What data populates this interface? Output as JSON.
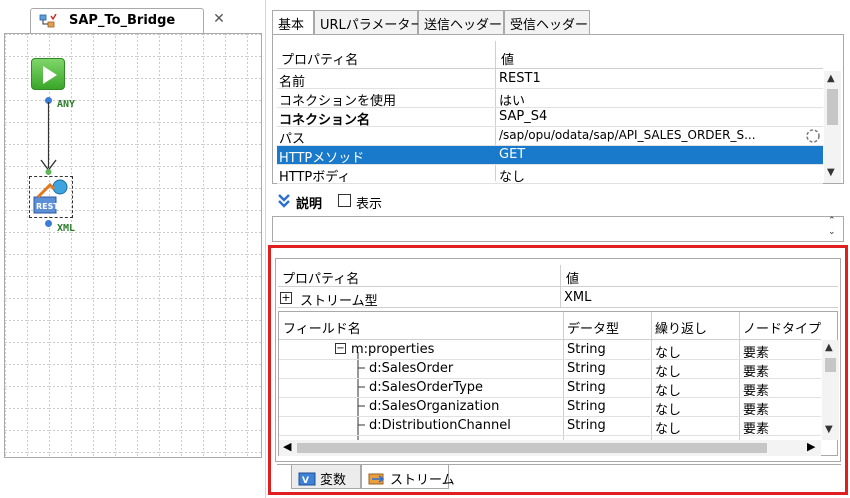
{
  "flow_tab": {
    "title": "SAP_To_Bridge",
    "close_glyph": "✕"
  },
  "flow": {
    "start_port_label": "ANY",
    "rest_port_label": "XML"
  },
  "property_tabs": [
    "基本",
    "URLパラメーター",
    "送信ヘッダー",
    "受信ヘッダー"
  ],
  "properties": {
    "header": {
      "name": "プロパティ名",
      "value": "値"
    },
    "rows": [
      {
        "key": "名前",
        "value": "REST1"
      },
      {
        "key": "コネクションを使用",
        "value": "はい"
      },
      {
        "key": "コネクション名",
        "value": "SAP_S4"
      },
      {
        "key": "パス",
        "value": "/sap/opu/odata/sap/API_SALES_ORDER_S..."
      },
      {
        "key": "HTTPメソッド",
        "value": "GET"
      },
      {
        "key": "HTTPボディ",
        "value": "なし"
      }
    ],
    "selected_row": 4
  },
  "description": {
    "label": "説明",
    "checkbox_label": "表示"
  },
  "stream": {
    "header": {
      "name": "プロパティ名",
      "value": "値"
    },
    "type_row": {
      "key": "ストリーム型",
      "value": "XML",
      "expander": "⊞"
    },
    "field_columns": [
      "フィールド名",
      "データ型",
      "繰り返し",
      "ノードタイプ"
    ],
    "fields": [
      {
        "name": "m:properties",
        "type": "String",
        "repeat": "なし",
        "node": "要素"
      },
      {
        "name": "d:SalesOrder",
        "type": "String",
        "repeat": "なし",
        "node": "要素"
      },
      {
        "name": "d:SalesOrderType",
        "type": "String",
        "repeat": "なし",
        "node": "要素"
      },
      {
        "name": "d:SalesOrganization",
        "type": "String",
        "repeat": "なし",
        "node": "要素"
      },
      {
        "name": "d:DistributionChannel",
        "type": "String",
        "repeat": "なし",
        "node": "要素"
      }
    ]
  },
  "bottom_tabs": [
    {
      "label": "変数"
    },
    {
      "label": "ストリーム"
    }
  ],
  "colors": {
    "selection": "#1979ca",
    "highlight_frame": "#e02020",
    "start_green": "#3aa62a",
    "port_blue": "#3b7cd8"
  }
}
